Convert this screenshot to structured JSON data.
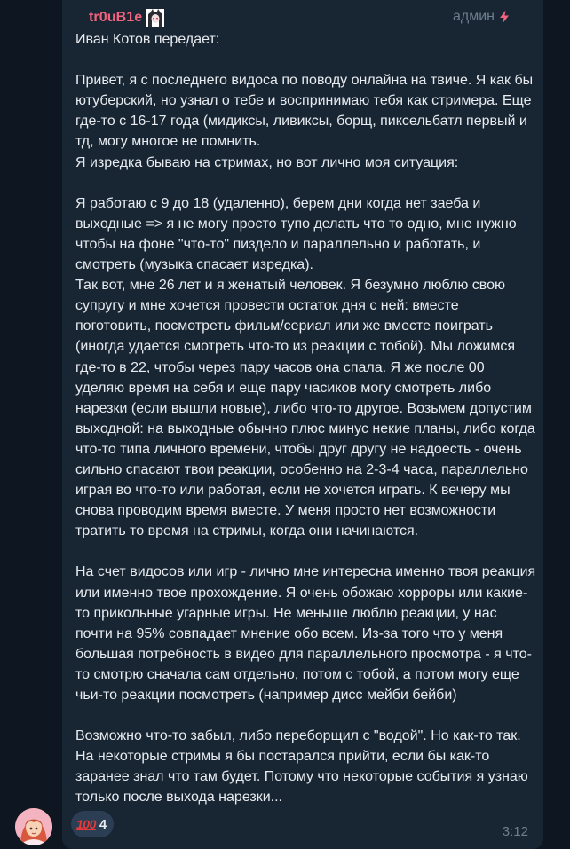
{
  "message": {
    "sender": "tr0uB1e",
    "role": "админ",
    "role_icon": "lightning-icon",
    "sender_sticker": "anime-character-sticker-icon",
    "text": "Иван Котов передает:\n\nПривет, я с последнего видоса по поводу онлайна на твиче. Я как бы ютуберский, но узнал о тебе и воспринимаю тебя как стримера. Еще где-то с 16-17 года (мидиксы, ливиксы, борщ, пиксельбатл первый и тд, могу многое не помнить.\nЯ изредка бываю на стримах, но вот лично моя ситуация:\n\nЯ работаю с 9 до 18 (удаленно), берем дни когда нет заеба и выходные => я не могу просто тупо делать что то одно, мне нужно чтобы на фоне \"что-то\" пиздело и параллельно и работать, и смотреть (музыка спасает изредка).\nТак вот, мне 26 лет и я женатый человек. Я безумно люблю свою супругу и мне хочется провести остаток дня с ней: вместе поготовить, посмотреть фильм/сериал или же вместе поиграть (иногда удается смотреть что-то из реакции с тобой). Мы ложимся где-то в 22, чтобы через пару часов она спала. Я же после 00 уделяю время на себя и еще пару часиков могу смотреть либо нарезки (если вышли новые), либо что-то другое. Возьмем допустим выходной: на выходные обычно плюс минус некие планы, либо когда что-то типа личного времени, чтобы друг другу не надоесть - очень сильно спасают твои реакции, особенно на 2-3-4 часа, параллельно играя во что-то или работая, если не хочется играть. К вечеру мы снова проводим время вместе. У меня просто нет возможности тратить то время на стримы, когда они начинаются.\n\nНа счет видосов или игр - лично мне интересна именно твоя реакция или именно твое прохождение. Я очень обожаю хорроры или какие-то прикольные угарные игры. Не меньше люблю реакции, у нас почти на 95% совпадает мнение обо всем. Из-за того что у меня большая потребность в видео для параллельного просмотра - я что-то смотрю сначала сам отдельно, потом с тобой, а потом могу еще чьи-то реакции посмотреть (например дисс мейби бейби)\n\nВозможно что-то забыл, либо переборщил с \"водой\". Но как-то так. На некоторые стримы я бы постарался прийти, если бы как-то заранее знал что там будет. Потому что некоторые события я узнаю только после выхода нарезки...",
    "reaction": {
      "emoji": "💯",
      "emoji_icon": "hundred-points-icon",
      "count": "4"
    },
    "time": "3:12"
  },
  "colors": {
    "background": "#0e1621",
    "bubble": "#182533",
    "sender_name": "#f2637d",
    "text": "#e7ebef",
    "meta": "#6d7f8f",
    "reaction_bg": "#2b3e54"
  }
}
